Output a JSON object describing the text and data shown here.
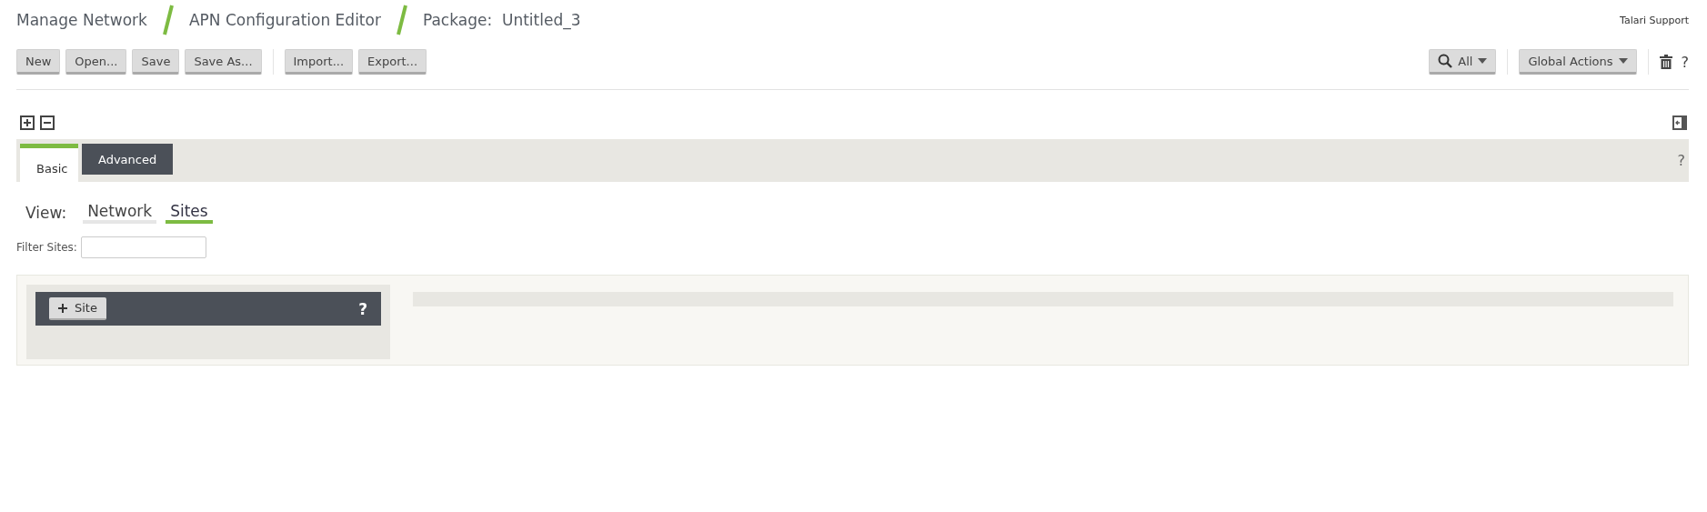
{
  "breadcrumb": [
    {
      "text": "Manage Network"
    },
    {
      "text": "APN Configuration Editor"
    },
    {
      "text": "Package:  Untitled_3"
    }
  ],
  "support_link": "Talari Support",
  "toolbar_left": [
    {
      "label": "New"
    },
    {
      "label": "Open..."
    },
    {
      "label": "Save"
    },
    {
      "label": "Save As..."
    },
    {
      "label": "Import...",
      "group_start": true
    },
    {
      "label": "Export..."
    }
  ],
  "search_filter": {
    "label": "All"
  },
  "global_actions": {
    "label": "Global Actions"
  },
  "help_mark": "?",
  "tabs": [
    {
      "label": "Basic",
      "selected": true
    },
    {
      "label": "Advanced",
      "selected": false
    }
  ],
  "tab_help": "?",
  "view": {
    "label": "View:",
    "options": [
      {
        "label": "Network",
        "selected": false
      },
      {
        "label": "Sites",
        "selected": true
      }
    ]
  },
  "filter": {
    "label": "Filter Sites:"
  },
  "site_panel": {
    "add_label": "Site",
    "help": "?"
  }
}
